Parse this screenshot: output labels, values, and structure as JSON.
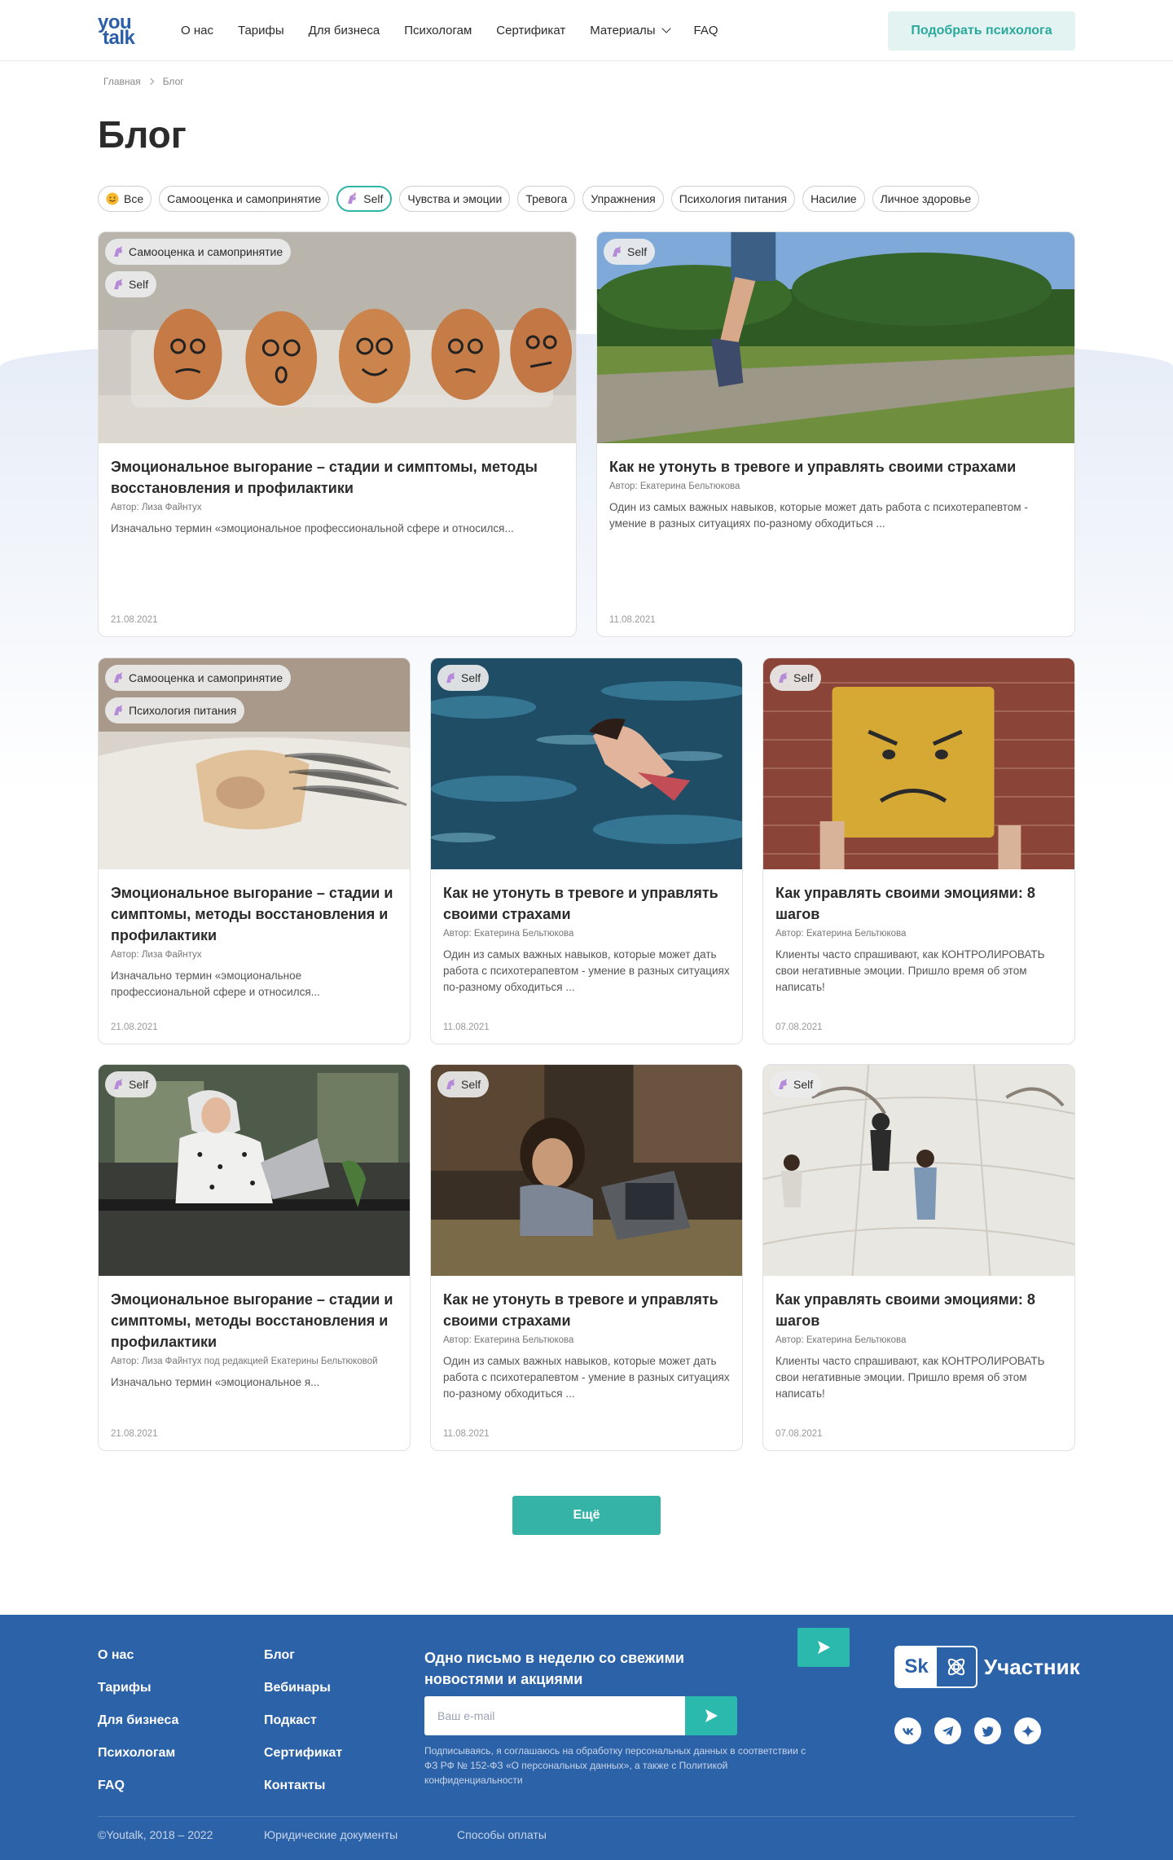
{
  "header": {
    "logo_top": "you",
    "logo_bottom": "talk",
    "nav": [
      "О нас",
      "Тарифы",
      "Для бизнеса",
      "Психологам",
      "Сертификат",
      "Материалы",
      "FAQ"
    ],
    "cta": "Подобрать психолога"
  },
  "breadcrumb": {
    "home": "Главная",
    "current": "Блог"
  },
  "page_title": "Блог",
  "filters": [
    {
      "label": "Все",
      "icon": "smile-icon",
      "active": false
    },
    {
      "label": "Самооценка и самопринятие",
      "icon": "",
      "active": false
    },
    {
      "label": "Self",
      "icon": "unicorn-icon",
      "active": true
    },
    {
      "label": "Чувства и эмоции",
      "icon": "",
      "active": false
    },
    {
      "label": "Тревога",
      "icon": "",
      "active": false
    },
    {
      "label": "Упражнения",
      "icon": "",
      "active": false
    },
    {
      "label": "Психология питания",
      "icon": "",
      "active": false
    },
    {
      "label": "Насилие",
      "icon": "",
      "active": false
    },
    {
      "label": "Личное здоровье",
      "icon": "",
      "active": false
    }
  ],
  "cards": [
    {
      "image": "eggs-image",
      "tags": [
        "Самооценка и самопринятие",
        "Self"
      ],
      "title": "Эмоциональное выгорание – стадии и симптомы, методы восстановления и профилактики",
      "author": "Автор: Лиза Файнтух",
      "excerpt": "Изначально термин «эмоциональное профессиональной сфере и относился...",
      "date": "21.08.2021"
    },
    {
      "image": "runner-image",
      "tags": [
        "Self"
      ],
      "title": "Как не утонуть в тревоге и управлять своими страхами",
      "author": "Автор: Екатерина Бельтюкова",
      "excerpt": "Один из самых важных навыков, которые может дать работа с психотерапевтом - умение в разных ситуациях по-разному обходиться ...",
      "date": "11.08.2021"
    },
    {
      "image": "bed-image",
      "tags": [
        "Самооценка и самопринятие",
        "Психология питания"
      ],
      "title": "Эмоциональное выгорание – стадии и симптомы, методы восстановления и профилактики",
      "author": "Автор: Лиза Файнтух",
      "excerpt": "Изначально термин «эмоциональное профессиональной сфере и относился...",
      "date": "21.08.2021"
    },
    {
      "image": "water-image",
      "tags": [
        "Self"
      ],
      "title": "Как не утонуть в тревоге и управлять своими страхами",
      "author": "Автор: Екатерина Бельтюкова",
      "excerpt": "Один из самых важных навыков, которые может дать работа с психотерапевтом - умение в разных ситуациях по-разному обходиться ...",
      "date": "11.08.2021"
    },
    {
      "image": "angry-face-image",
      "tags": [
        "Self"
      ],
      "title": "Как управлять своими эмоциями: 8 шагов",
      "author": "Автор: Екатерина Бельтюкова",
      "excerpt": "Клиенты часто спрашивают, как КОНТРОЛИРОВАТЬ свои негативные эмоции. Пришло время об этом написать!",
      "date": "07.08.2021"
    },
    {
      "image": "laptop-woman-image",
      "tags": [
        "Self"
      ],
      "title": "Эмоциональное выгорание – стадии и симптомы, методы восстановления и профилактики",
      "author": "Автор: Лиза Файнтух под редакцией  Екатерины Бельтюковой",
      "excerpt": "Изначально термин «эмоциональное я...",
      "date": "21.08.2021"
    },
    {
      "image": "video-call-image",
      "tags": [
        "Self"
      ],
      "title": "Как не утонуть в тревоге и управлять своими страхами",
      "author": "Автор: Екатерина Бельтюкова",
      "excerpt": "Один из самых важных навыков, которые может дать работа с психотерапевтом - умение в разных ситуациях по-разному обходиться ...",
      "date": "11.08.2021"
    },
    {
      "image": "people-walking-image",
      "tags": [
        "Self"
      ],
      "title": "Как управлять своими эмоциями: 8 шагов",
      "author": "Автор: Екатерина Бельтюкова",
      "excerpt": "Клиенты часто спрашивают, как КОНТРОЛИРОВАТЬ свои негативные эмоции. Пришло время об этом написать!",
      "date": "07.08.2021"
    }
  ],
  "more_button": "Ещё",
  "footer": {
    "col1": [
      "О нас",
      "Тарифы",
      "Для бизнеса",
      "Психологам",
      "FAQ"
    ],
    "col2": [
      "Блог",
      "Вебинары",
      "Подкаст",
      "Сертификат",
      "Контакты"
    ],
    "newsletter_title": "Одно письмо в неделю со свежими новостями и акциями",
    "email_placeholder": "Ваш e-mail",
    "consent": "Подписываясь, я соглашаюсь на обработку персональных данных в соответствии с ФЗ РФ № 152-ФЗ «О персональных данных», а также с Политикой конфиденциальности",
    "sk_logo": "Sk",
    "sk_label": "Участник",
    "socials": [
      "vk-icon",
      "telegram-icon",
      "twitter-icon",
      "star-icon"
    ],
    "copyright": "©Youtalk, 2018 – 2022",
    "legal": "Юридические документы",
    "payment": "Способы оплаты"
  },
  "colors": {
    "accent": "#35b3a6",
    "footer_bg": "#2c62a8",
    "cta_bg": "#e3f3f2"
  }
}
